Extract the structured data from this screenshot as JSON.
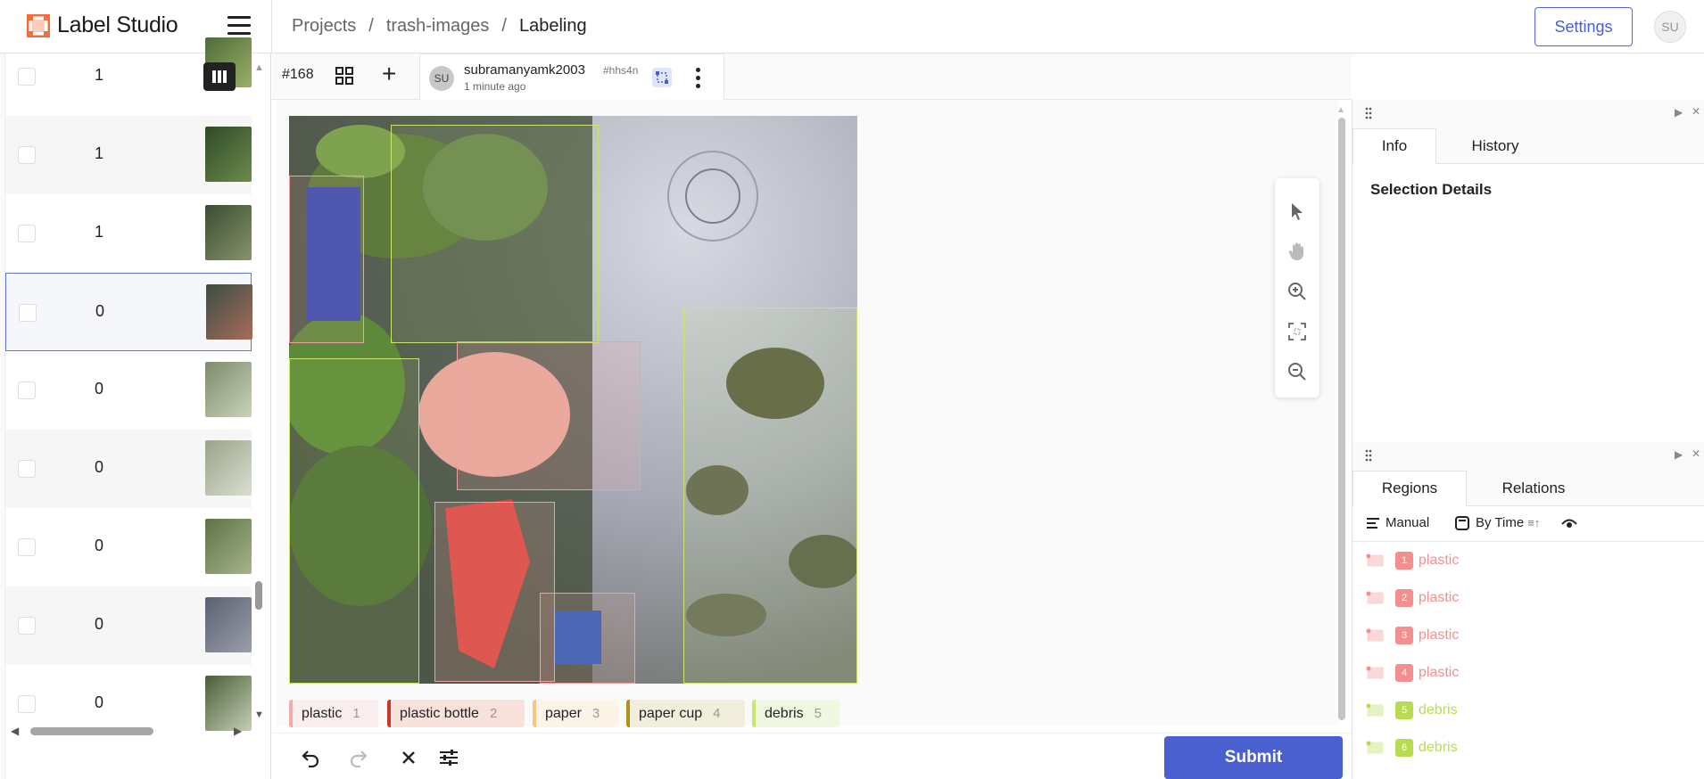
{
  "app": {
    "title": "Label Studio"
  },
  "breadcrumb": [
    "Projects",
    "/",
    "trash-images",
    "/",
    "Labeling"
  ],
  "header": {
    "settings_label": "Settings",
    "user_initials": "SU"
  },
  "task_list": {
    "rows": [
      {
        "value": "1"
      },
      {
        "value": "1"
      },
      {
        "value": "1"
      },
      {
        "value": "0"
      },
      {
        "value": "0"
      },
      {
        "value": "0"
      },
      {
        "value": "0"
      },
      {
        "value": "0"
      },
      {
        "value": "0"
      }
    ],
    "selected_index": 3
  },
  "annotation_bar": {
    "task_id": "#168",
    "avatar": "SU",
    "user": "subramanyamk2003",
    "hash": "#hhs4n",
    "time": "1 minute ago"
  },
  "labels": [
    {
      "name": "plastic",
      "key": "1",
      "color": "#f7a8a8",
      "bg": "#fbeeee"
    },
    {
      "name": "plastic bottle",
      "key": "2",
      "color": "#c83a2a",
      "bg": "#f9e2dc"
    },
    {
      "name": "paper",
      "key": "3",
      "color": "#f6c77e",
      "bg": "#fcf4e6"
    },
    {
      "name": "paper cup",
      "key": "4",
      "color": "#b39118",
      "bg": "#f1eedb"
    },
    {
      "name": "debris",
      "key": "5",
      "color": "#c9e86b",
      "bg": "#f1f8e2"
    }
  ],
  "bottom_bar": {
    "submit_label": "Submit"
  },
  "info_panel": {
    "tabs": [
      "Info",
      "History"
    ],
    "active_tab": "Info",
    "selection_title": "Selection Details"
  },
  "regions_panel": {
    "tabs": [
      "Regions",
      "Relations"
    ],
    "active_tab": "Regions",
    "toolbar": {
      "manual": "Manual",
      "by_time": "By Time"
    },
    "regions": [
      {
        "num": "1",
        "label": "plastic",
        "color": "#f48f8f"
      },
      {
        "num": "2",
        "label": "plastic",
        "color": "#f48f8f"
      },
      {
        "num": "3",
        "label": "plastic",
        "color": "#f48f8f"
      },
      {
        "num": "4",
        "label": "plastic",
        "color": "#f48f8f"
      },
      {
        "num": "5",
        "label": "debris",
        "color": "#b7dc52"
      },
      {
        "num": "6",
        "label": "debris",
        "color": "#b7dc52"
      }
    ]
  },
  "icons": {
    "tools": [
      "select-pointer-icon",
      "pan-hand-icon",
      "zoom-in-icon",
      "fit-screen-icon",
      "zoom-out-icon"
    ],
    "bottom": [
      "undo-icon",
      "redo-icon",
      "reset-icon",
      "settings-sliders-icon"
    ]
  }
}
